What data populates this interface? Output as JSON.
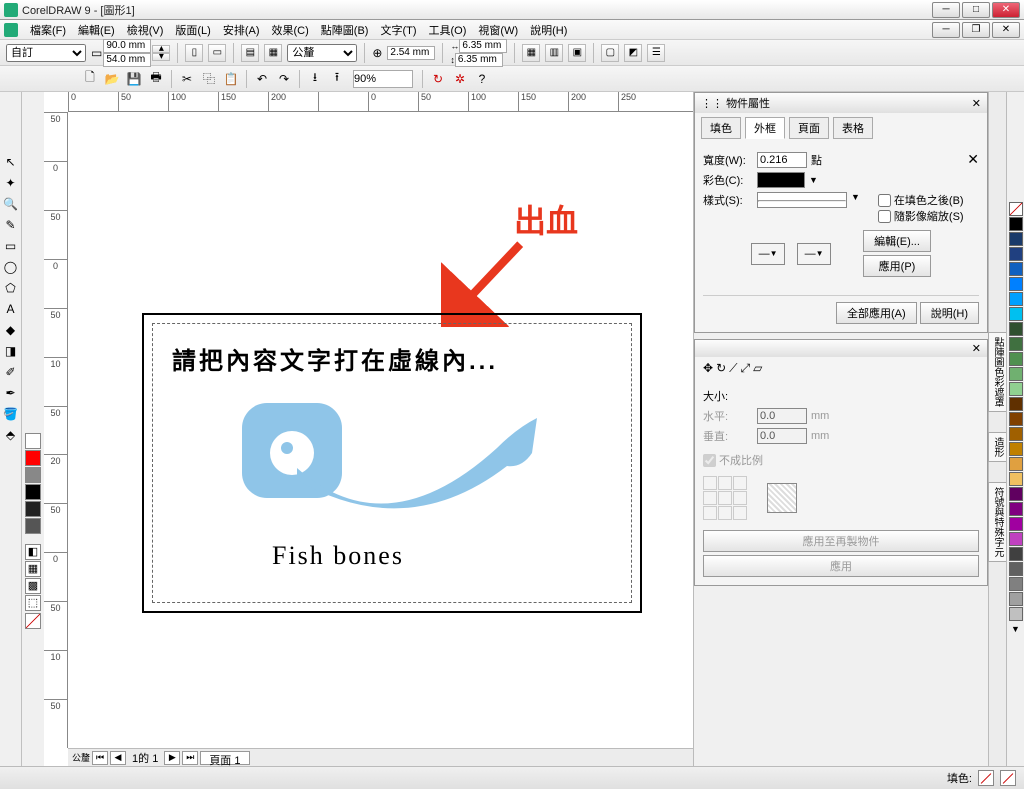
{
  "titlebar": {
    "app": "CorelDRAW 9 - [圖形1]"
  },
  "menu": [
    "檔案(F)",
    "編輯(E)",
    "檢視(V)",
    "版面(L)",
    "安排(A)",
    "效果(C)",
    "點陣圖(B)",
    "文字(T)",
    "工具(O)",
    "視窗(W)",
    "說明(H)"
  ],
  "propbar": {
    "preset": "自訂",
    "w": "90.0 mm",
    "h": "54.0 mm",
    "units": "公釐",
    "nudge": "2.54 mm",
    "dup_x": "6.35 mm",
    "dup_y": "6.35 mm"
  },
  "toolbar": {
    "zoom": "90%"
  },
  "rulers_h": [
    "0",
    "50",
    "100",
    "150",
    "200",
    "",
    "0",
    "50",
    "100",
    "150",
    "200",
    "250"
  ],
  "rulers_v": [
    "50",
    "0",
    "50",
    "0",
    "50",
    "10",
    "50",
    "20",
    "50",
    "0",
    "50",
    "10",
    "50"
  ],
  "canvas": {
    "annotation": "出血",
    "instruction": "請把內容文字打在虛線內...",
    "fish_label": "Fish bones"
  },
  "pagenav": {
    "pos": "1的 1",
    "tab": "頁面  1"
  },
  "docker1": {
    "title": "物件屬性",
    "tabs": [
      "填色",
      "外框",
      "頁面",
      "表格"
    ],
    "active_tab": 1,
    "width_label": "寬度(W):",
    "width_val": "0.216",
    "width_unit": "點",
    "color_label": "彩色(C):",
    "style_label": "樣式(S):",
    "behind_fill": "在填色之後(B)",
    "scale_image": "隨影像縮放(S)",
    "edit_btn": "編輯(E)...",
    "apply_btn": "應用(P)",
    "apply_all": "全部應用(A)",
    "help": "說明(H)"
  },
  "docker2": {
    "size_label": "大小:",
    "h_label": "水平:",
    "h_val": "0.0",
    "h_unit": "mm",
    "v_label": "垂直:",
    "v_val": "0.0",
    "v_unit": "mm",
    "nonprop": "不成比例",
    "apply_dup": "應用至再製物件",
    "apply": "應用"
  },
  "side_tabs": [
    "點陣圖色彩遮罩",
    "造形",
    "符號與特殊字元"
  ],
  "status": {
    "fill_label": "填色:"
  },
  "palette_left": [
    "#ffffff",
    "#ff0000",
    "#888888",
    "#000000",
    "#222222",
    "#555555"
  ],
  "palette_shapes": [
    "◧",
    "▦",
    "▩",
    "⬚"
  ],
  "palette_right": [
    "#000000",
    "#1a3a6a",
    "#204080",
    "#1060c0",
    "#0080ff",
    "#00a0ff",
    "#00c0f0",
    "#305030",
    "#407040",
    "#509050",
    "#70b070",
    "#90d090",
    "#603000",
    "#804000",
    "#a06000",
    "#c08000",
    "#e0a040",
    "#f0c060",
    "#600060",
    "#800080",
    "#a000a0",
    "#c040c0",
    "#404040",
    "#606060",
    "#808080",
    "#a0a0a0",
    "#c0c0c0"
  ]
}
